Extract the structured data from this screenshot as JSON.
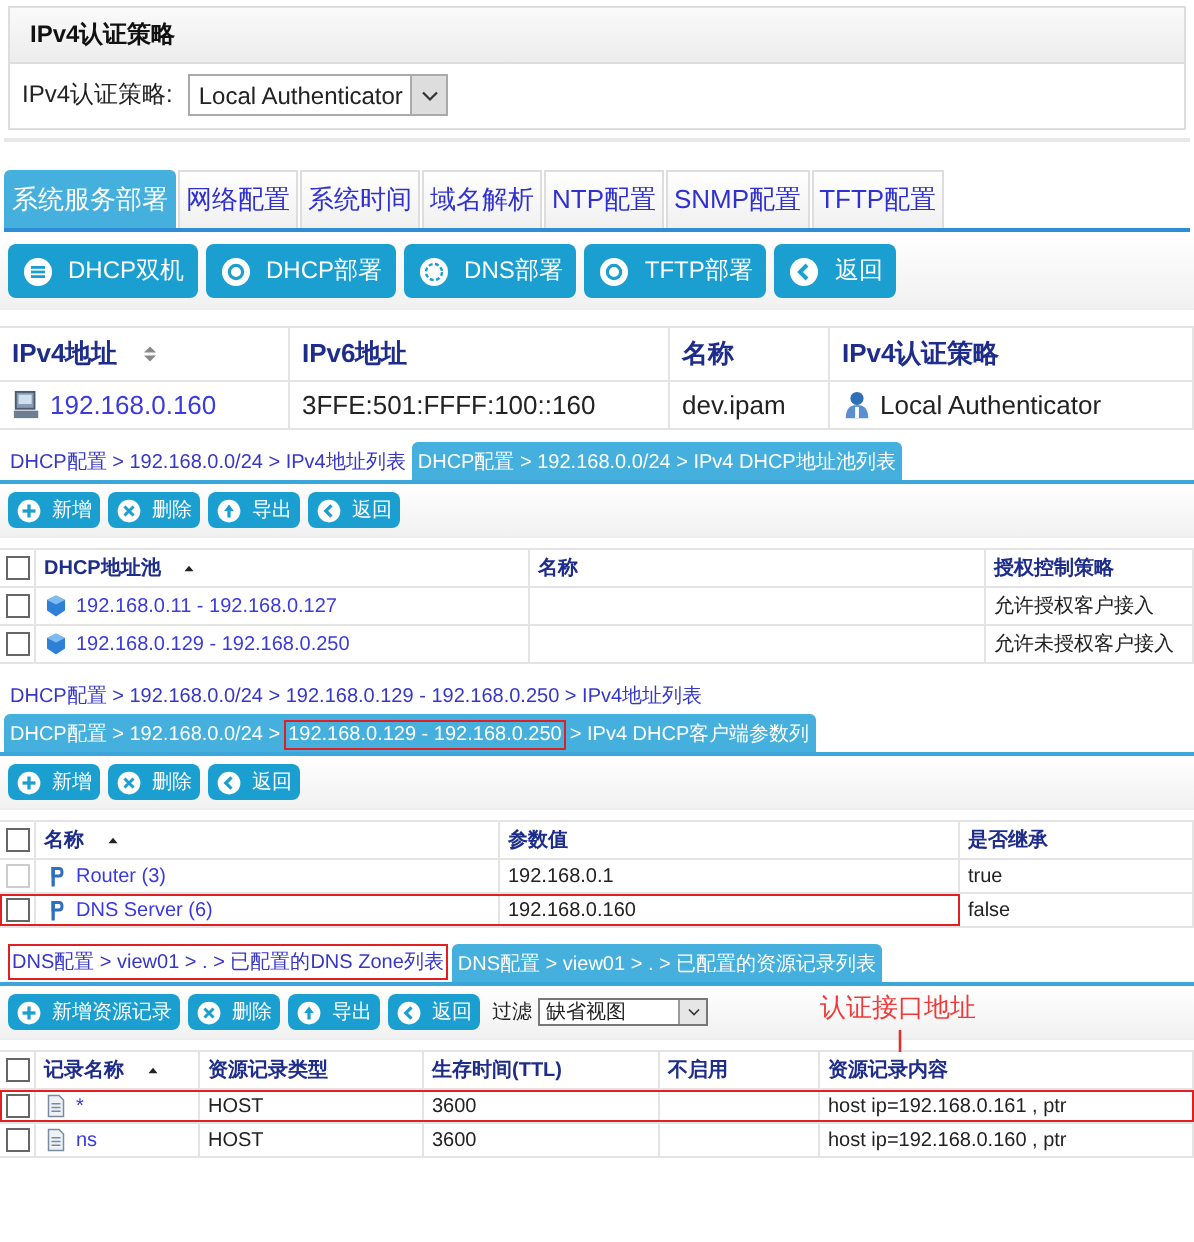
{
  "auth_policy": {
    "title": "IPv4认证策略",
    "label": "IPv4认证策略:",
    "value": "Local Authenticator"
  },
  "tabs": [
    {
      "label": "系统服务部署",
      "selected": true
    },
    {
      "label": "网络配置",
      "selected": false
    },
    {
      "label": "系统时间",
      "selected": false
    },
    {
      "label": "域名解析",
      "selected": false
    },
    {
      "label": "NTP配置",
      "selected": false
    },
    {
      "label": "SNMP配置",
      "selected": false
    },
    {
      "label": "TFTP配置",
      "selected": false
    }
  ],
  "toolbar": [
    {
      "label": "DHCP双机"
    },
    {
      "label": "DHCP部署"
    },
    {
      "label": "DNS部署"
    },
    {
      "label": "TFTP部署"
    },
    {
      "label": "返回"
    }
  ],
  "server_table": {
    "columns": [
      {
        "label": "IPv4地址"
      },
      {
        "label": "IPv6地址"
      },
      {
        "label": "名称"
      },
      {
        "label": "IPv4认证策略"
      }
    ],
    "rows": [
      {
        "cells": [
          "192.168.0.160",
          "3FFE:501:FFFF:100::160",
          "dev.ipam",
          "Local Authenticator"
        ]
      }
    ]
  },
  "sections": [
    {
      "breadcrumbs": [
        {
          "selected": false,
          "parts": [
            {
              "text": "DHCP配置 > 192.168.0.0/24 > IPv4地址列表",
              "highlighted": false
            }
          ]
        },
        {
          "selected": true,
          "parts": [
            {
              "text": "DHCP配置 > 192.168.0.0/24 > IPv4 DHCP地址池列表",
              "highlighted": false
            }
          ]
        }
      ],
      "buttons": [
        {
          "label": "新增"
        },
        {
          "label": "删除"
        },
        {
          "label": "导出"
        },
        {
          "label": "返回"
        }
      ],
      "table": {
        "all_checked": false,
        "columns": [
          {
            "label": "DHCP地址池"
          },
          {
            "label": "名称"
          },
          {
            "label": "授权控制策略"
          }
        ],
        "rows": [
          {
            "checked": false,
            "cells": [
              "192.168.0.11 - 192.168.0.127",
              "",
              "允许授权客户接入"
            ]
          },
          {
            "checked": false,
            "cells": [
              "192.168.0.129 - 192.168.0.250",
              "",
              "允许未授权客户接入"
            ]
          }
        ]
      }
    },
    {
      "breadcrumbs": [
        {
          "selected": false,
          "parts": [
            {
              "text": "DHCP配置 > 192.168.0.0/24 > 192.168.0.129 - 192.168.0.250 > IPv4地址列表",
              "highlighted": false
            }
          ]
        },
        {
          "selected": true,
          "parts": [
            {
              "text": "DHCP配置 > 192.168.0.0/24 >",
              "highlighted": false
            },
            {
              "text": "192.168.0.129 - 192.168.0.250",
              "highlighted": true
            },
            {
              "text": "> IPv4 DHCP客户端参数列",
              "highlighted": false
            }
          ]
        }
      ],
      "buttons": [
        {
          "label": "新增"
        },
        {
          "label": "删除"
        },
        {
          "label": "返回"
        }
      ],
      "table": {
        "all_checked": false,
        "columns": [
          {
            "label": "名称"
          },
          {
            "label": "参数值"
          },
          {
            "label": "是否继承"
          }
        ],
        "rows": [
          {
            "checked": false,
            "disabled": true,
            "highlighted": false,
            "cells": [
              "Router (3)",
              "192.168.0.1",
              "true"
            ]
          },
          {
            "checked": false,
            "disabled": false,
            "highlighted": true,
            "cells": [
              "DNS Server (6)",
              "192.168.0.160",
              "false"
            ]
          }
        ]
      }
    },
    {
      "breadcrumbs": [
        {
          "selected": false,
          "parts": [
            {
              "text": "DNS配置 > view01 > . > 已配置的DNS Zone列表",
              "highlighted": true
            }
          ]
        },
        {
          "selected": true,
          "parts": [
            {
              "text": "DNS配置 > view01 > . > 已配置的资源记录列表",
              "highlighted": false
            }
          ]
        }
      ],
      "buttons": [
        {
          "label": "新增资源记录"
        },
        {
          "label": "删除"
        },
        {
          "label": "导出"
        },
        {
          "label": "返回"
        }
      ],
      "filter": {
        "label": "过滤",
        "value": "缺省视图"
      },
      "annotation": {
        "text": "认证接口地址"
      },
      "table": {
        "all_checked": false,
        "columns": [
          {
            "label": "记录名称"
          },
          {
            "label": "资源记录类型"
          },
          {
            "label": "生存时间(TTL)"
          },
          {
            "label": "不启用"
          },
          {
            "label": "资源记录内容"
          }
        ],
        "rows": [
          {
            "checked": false,
            "highlighted": true,
            "cells": [
              "*",
              "HOST",
              "3600",
              "",
              "host ip=192.168.0.161 , ptr"
            ]
          },
          {
            "checked": false,
            "highlighted": false,
            "cells": [
              "ns",
              "HOST",
              "3600",
              "",
              "host ip=192.168.0.160 , ptr"
            ]
          }
        ]
      }
    }
  ]
}
